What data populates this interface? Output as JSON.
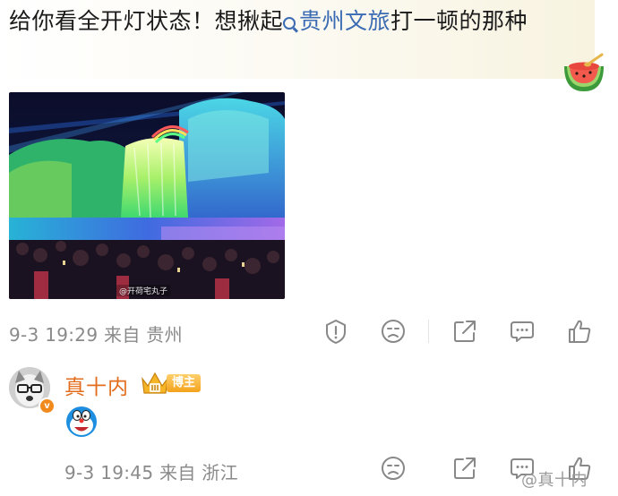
{
  "post": {
    "text_before": "给你看全开灯状态！想揪起",
    "topic": "贵州文旅",
    "text_after": "打一顿的那种",
    "photo_watermark": "@开荷宅丸子",
    "time": "9-3 19:29",
    "source": "来自 贵州"
  },
  "comment": {
    "username": "真十内",
    "badge_label": "博主",
    "time": "9-3 19:45",
    "source": "来自 浙江"
  },
  "footer": {
    "watermark": "@真十内"
  },
  "colors": {
    "topic_link": "#3b6bb3",
    "username": "#e36d1e",
    "meta_text": "#8a8a8a",
    "icon_stroke": "#888888"
  },
  "icons": {
    "post_actions": [
      "report-icon",
      "dislike-face-icon",
      "share-icon",
      "comment-icon",
      "like-icon"
    ],
    "comment_actions": [
      "dislike-face-icon",
      "share-icon",
      "comment-icon",
      "like-icon"
    ],
    "decor": [
      "watermelon-emoji-icon",
      "doraemon-sticker-icon",
      "crown-icon",
      "search-icon"
    ]
  }
}
